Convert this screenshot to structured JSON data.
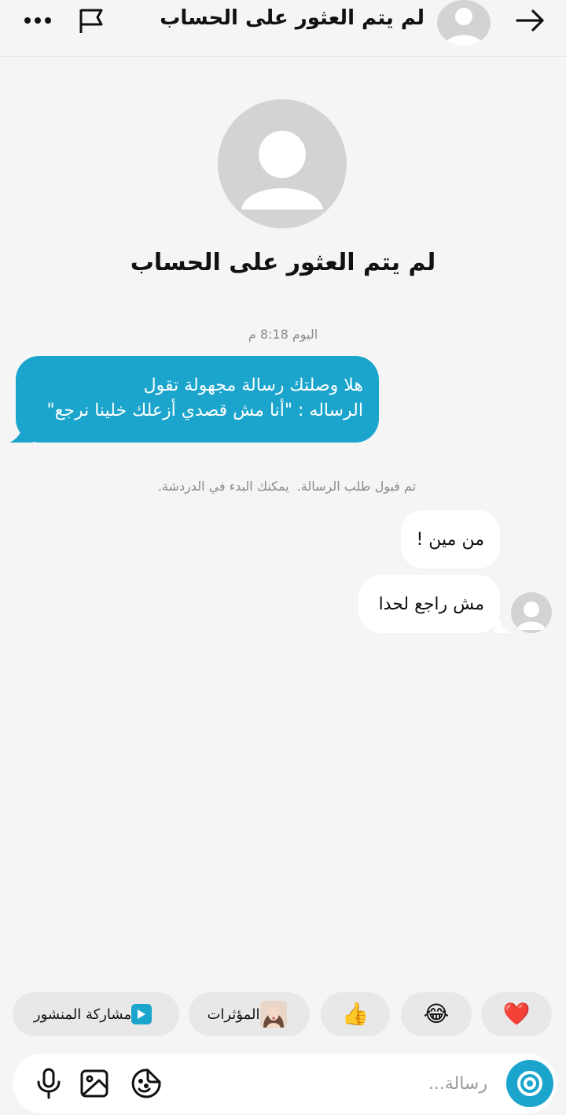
{
  "header": {
    "title": "لم يتم العثور على الحساب",
    "back_icon": "arrow-right-icon",
    "flag_icon": "flag-icon",
    "more_icon": "more-horizontal-icon"
  },
  "profile": {
    "name": "لم يتم العثور على الحساب"
  },
  "chat": {
    "timestamp": "اليوم 8:18 م",
    "outgoing": {
      "line1": "هلا وصلتك رسالة مجهولة تقول",
      "line2": "الرساله : \"أنا مش قصدي أزعلك خلينا نرجع\""
    },
    "system_part1": "تم قبول طلب الرسالة.",
    "system_part2": "يمكنك البدء في الدردشة.",
    "incoming": [
      {
        "text": "من مين !"
      },
      {
        "text": "مش راجع لحدا"
      }
    ]
  },
  "quick_replies": {
    "heart": "❤️",
    "laugh": "😂",
    "thumbs_up": "👍",
    "influencers": "المؤثرات",
    "share_post": "مشاركة المنشور"
  },
  "composer": {
    "placeholder": "رسالة..."
  },
  "colors": {
    "accent": "#1ba5cd",
    "background": "#f5f5f5",
    "bubble_in": "#ffffff",
    "chip": "#e8e8e8"
  }
}
